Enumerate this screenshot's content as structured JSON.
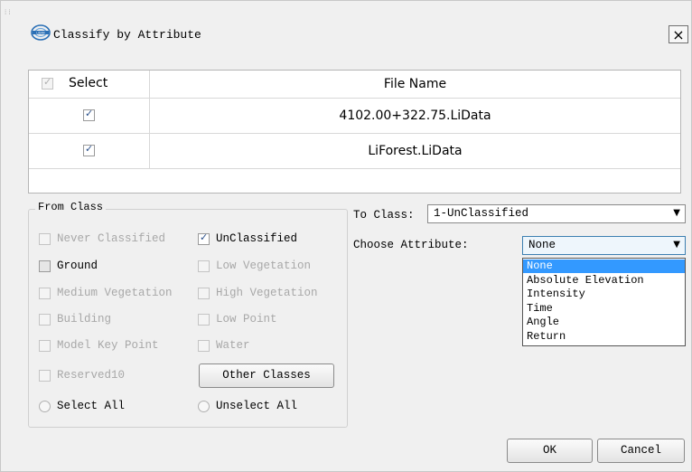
{
  "dialog": {
    "title": "Classify by Attribute",
    "close_label": "×",
    "app_icon": "lidar-logo-icon"
  },
  "table": {
    "select_header": "Select",
    "name_header": "File Name",
    "rows": [
      {
        "checked": true,
        "file_name": "4102.00+322.75.LiData"
      },
      {
        "checked": true,
        "file_name": "LiForest.LiData"
      }
    ]
  },
  "from_class": {
    "label": "From Class",
    "items": [
      {
        "label": "Never Classified",
        "checked": false,
        "enabled": false
      },
      {
        "label": "UnClassified",
        "checked": true,
        "enabled": true
      },
      {
        "label": "Ground",
        "checked": false,
        "enabled": true
      },
      {
        "label": "Low Vegetation",
        "checked": false,
        "enabled": false
      },
      {
        "label": "Medium Vegetation",
        "checked": false,
        "enabled": false
      },
      {
        "label": "High Vegetation",
        "checked": false,
        "enabled": false
      },
      {
        "label": "Building",
        "checked": false,
        "enabled": false
      },
      {
        "label": "Low Point",
        "checked": false,
        "enabled": false
      },
      {
        "label": "Model Key Point",
        "checked": false,
        "enabled": false
      },
      {
        "label": "Water",
        "checked": false,
        "enabled": false
      },
      {
        "label": "Reserved10",
        "checked": false,
        "enabled": false
      }
    ],
    "other_classes_label": "Other Classes",
    "select_all_label": "Select All",
    "unselect_all_label": "Unselect All"
  },
  "to_class": {
    "label": "To Class:",
    "value": "1-UnClassified"
  },
  "attribute": {
    "label": "Choose Attribute:",
    "value": "None",
    "options": [
      "None",
      "Absolute Elevation",
      "Intensity",
      "Time",
      "Angle",
      "Return"
    ],
    "selected_index": 0
  },
  "footer": {
    "ok_label": "OK",
    "cancel_label": "Cancel"
  },
  "colors": {
    "selection": "#3399ff",
    "disabled_text": "#a8a8a8"
  }
}
